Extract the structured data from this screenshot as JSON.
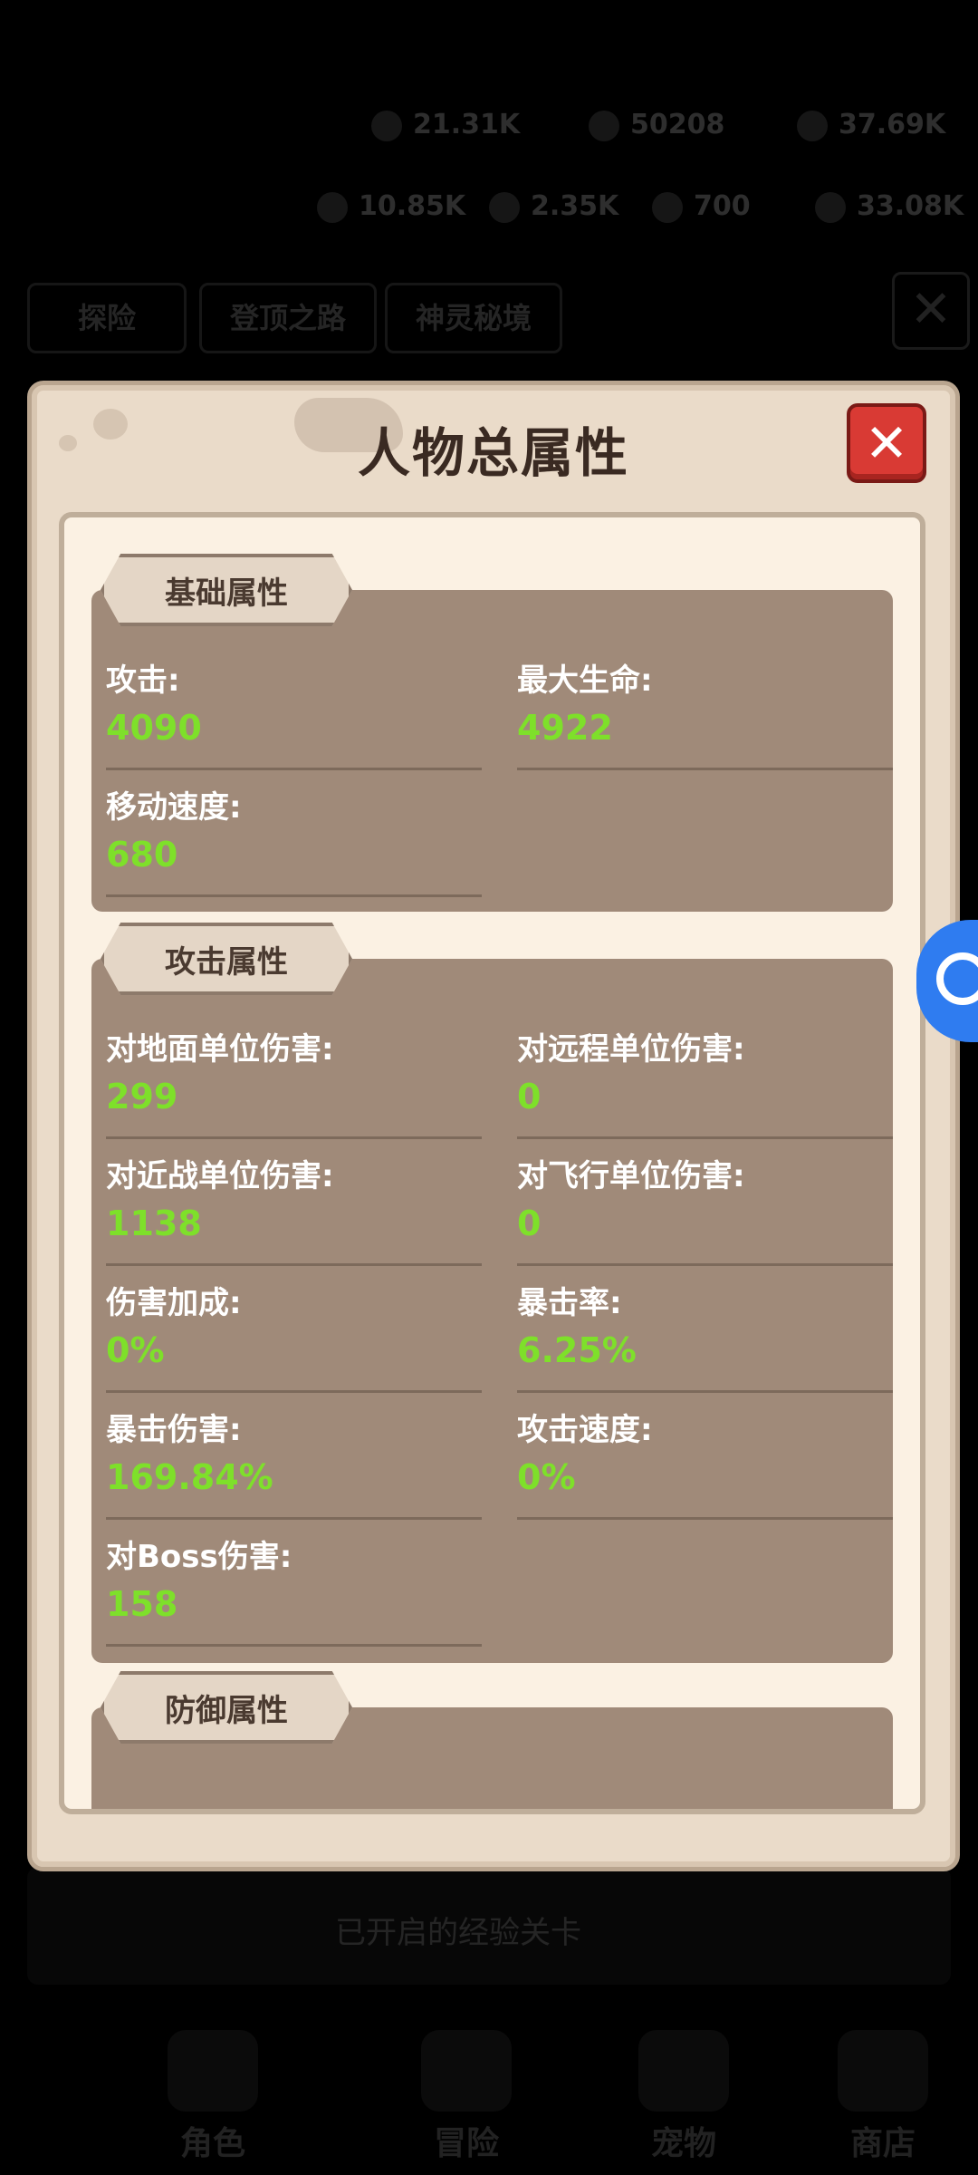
{
  "background": {
    "resources_row1": [
      "21.31K",
      "50208",
      "37.69K"
    ],
    "resources_row2": [
      "10.85K",
      "2.35K",
      "700",
      "33.08K"
    ],
    "tabs": [
      "探险",
      "登顶之路",
      "神灵秘境"
    ],
    "banner_text": "已开启的经验关卡",
    "nav": [
      "角色",
      "冒险",
      "宠物",
      "商店"
    ]
  },
  "modal": {
    "title": "人物总属性",
    "sections": [
      {
        "title": "基础属性",
        "items": [
          {
            "label": "攻击:",
            "value": "4090"
          },
          {
            "label": "最大生命:",
            "value": "4922"
          },
          {
            "label": "移动速度:",
            "value": "680"
          }
        ]
      },
      {
        "title": "攻击属性",
        "items": [
          {
            "label": "对地面单位伤害:",
            "value": "299"
          },
          {
            "label": "对远程单位伤害:",
            "value": "0"
          },
          {
            "label": "对近战单位伤害:",
            "value": "1138"
          },
          {
            "label": "对飞行单位伤害:",
            "value": "0"
          },
          {
            "label": "伤害加成:",
            "value": "0%"
          },
          {
            "label": "暴击率:",
            "value": "6.25%"
          },
          {
            "label": "暴击伤害:",
            "value": "169.84%"
          },
          {
            "label": "攻击速度:",
            "value": "0%"
          },
          {
            "label": "对Boss伤害:",
            "value": "158"
          }
        ]
      },
      {
        "title": "防御属性",
        "items": []
      }
    ]
  },
  "icons": {
    "close": "close-icon",
    "side": "game-controller-icon"
  },
  "colors": {
    "value_green": "#7ee02a",
    "panel_brown": "#a08a79",
    "close_red": "#d93a34"
  }
}
